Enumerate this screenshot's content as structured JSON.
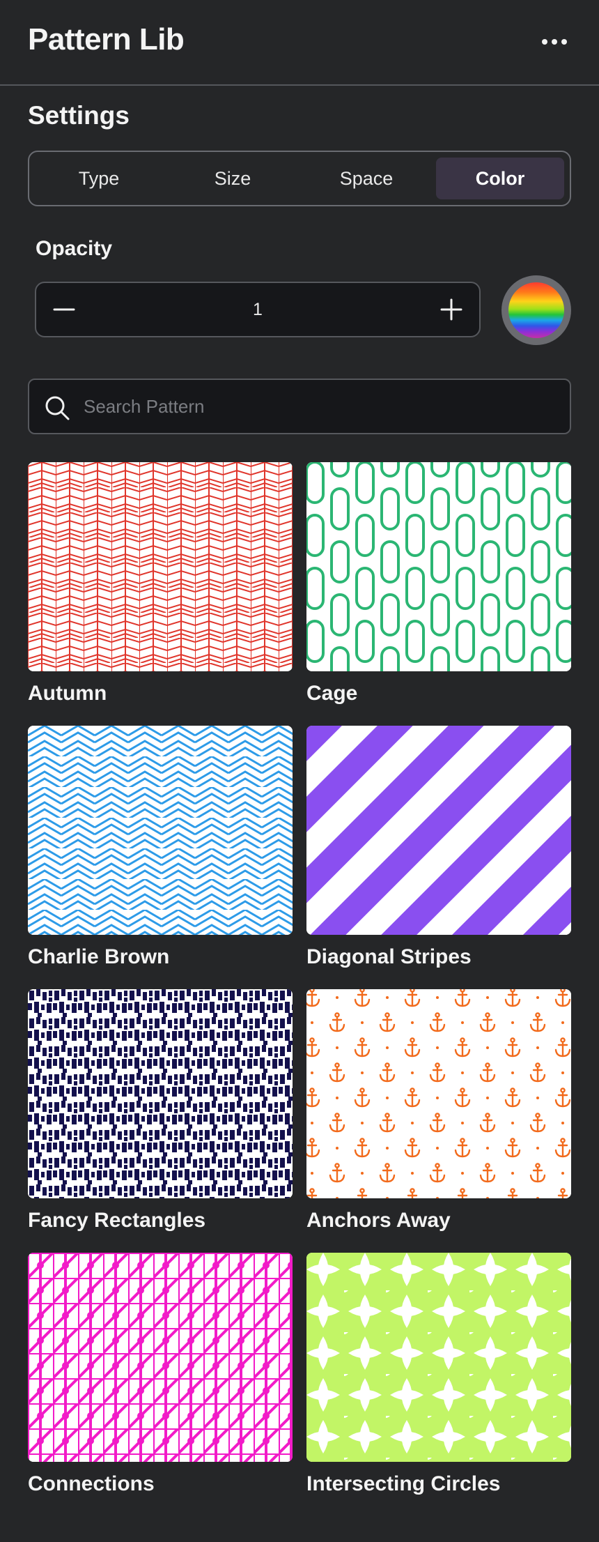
{
  "header": {
    "title": "Pattern Lib",
    "more_icon": "more-horizontal-icon"
  },
  "settings": {
    "title": "Settings",
    "tabs": [
      {
        "label": "Type",
        "active": false
      },
      {
        "label": "Size",
        "active": false
      },
      {
        "label": "Space",
        "active": false
      },
      {
        "label": "Color",
        "active": true
      }
    ],
    "opacity": {
      "label": "Opacity",
      "value": "1",
      "minus_icon": "minus-icon",
      "plus_icon": "plus-icon"
    },
    "color_swatch": {
      "icon": "rainbow-color-picker-icon"
    }
  },
  "search": {
    "placeholder": "Search Pattern",
    "value": "",
    "icon": "search-icon"
  },
  "patterns": [
    {
      "name": "Autumn",
      "color": "#e0352b"
    },
    {
      "name": "Cage",
      "color": "#2bb673"
    },
    {
      "name": "Charlie Brown",
      "color": "#2d9be8"
    },
    {
      "name": "Diagonal Stripes",
      "color": "#8a4ff0"
    },
    {
      "name": "Fancy Rectangles",
      "color": "#14114d"
    },
    {
      "name": "Anchors Away",
      "color": "#f26a1b"
    },
    {
      "name": "Connections",
      "color": "#f21bc8"
    },
    {
      "name": "Intersecting Circles",
      "color": "#c2f566"
    }
  ]
}
